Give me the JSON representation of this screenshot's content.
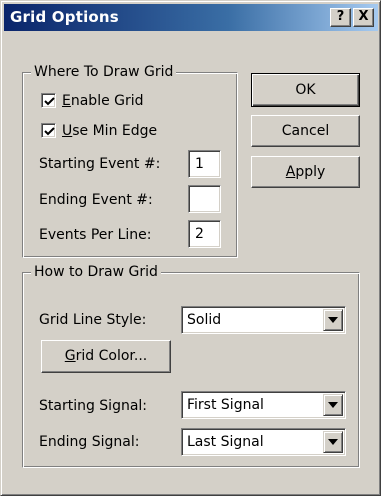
{
  "window": {
    "title": "Grid Options",
    "help_button": "?",
    "close_button": "X"
  },
  "where_group": {
    "legend": "Where To Draw Grid",
    "enable_grid": {
      "label_hotkey": "E",
      "label_rest": "nable Grid",
      "checked": true
    },
    "use_min_edge": {
      "label_hotkey": "U",
      "label_rest": "se Min Edge",
      "checked": true
    },
    "starting_event": {
      "label": "Starting Event #:",
      "value": "1"
    },
    "ending_event": {
      "label": "Ending Event #:",
      "value": ""
    },
    "events_per_line": {
      "label": "Events Per Line:",
      "value": "2"
    }
  },
  "buttons": {
    "ok": "OK",
    "cancel": "Cancel",
    "apply_hotkey": "A",
    "apply_rest": "pply"
  },
  "how_group": {
    "legend": "How to Draw Grid",
    "line_style": {
      "label": "Grid Line Style:",
      "value": "Solid"
    },
    "grid_color_hotkey": "G",
    "grid_color_rest": "rid Color...",
    "starting_signal": {
      "label": "Starting Signal:",
      "value": "First Signal"
    },
    "ending_signal": {
      "label": "Ending Signal:",
      "value": "Last Signal"
    }
  },
  "icons": {
    "check": "check-mark-icon",
    "dropdown": "chevron-down-icon"
  },
  "colors": {
    "title_gradient_start": "#0a246a",
    "title_gradient_end": "#a6caf0",
    "face": "#d4d0c8"
  }
}
